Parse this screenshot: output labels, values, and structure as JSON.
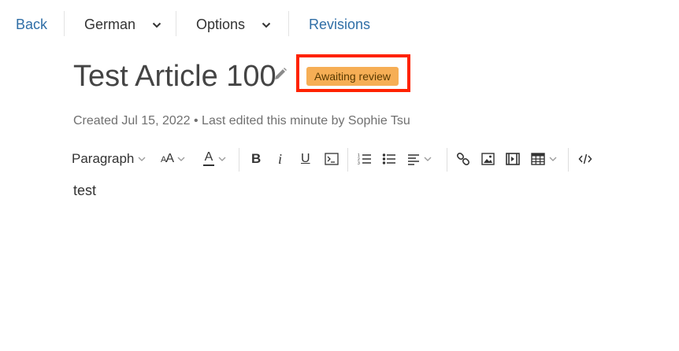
{
  "nav": {
    "back_label": "Back",
    "language_label": "German",
    "options_label": "Options",
    "revisions_label": "Revisions"
  },
  "article": {
    "title": "Test Article 100",
    "status_badge": "Awaiting review",
    "meta": "Created Jul 15, 2022 • Last edited this minute by Sophie Tsu",
    "body": "test"
  },
  "toolbar": {
    "paragraph_label": "Paragraph",
    "font_size_glyph": "AA",
    "font_color_glyph": "A",
    "bold_glyph": "B",
    "italic_glyph": "i",
    "underline_glyph": "U"
  },
  "colors": {
    "link": "#2f6ea6",
    "badge_bg": "#f6ae55",
    "highlight": "#ff2200"
  }
}
